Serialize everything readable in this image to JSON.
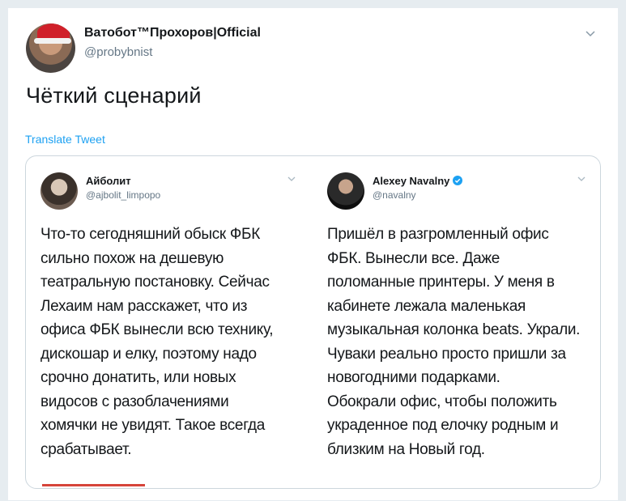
{
  "tweet": {
    "author_name": "Ватобот™Прохоров|Official",
    "author_handle": "@probybnist",
    "text": "Чёткий сценарий",
    "translate_label": "Translate Tweet",
    "caret_icon": "chevron-down-icon"
  },
  "media": {
    "left": {
      "author_name": "Айболит",
      "author_handle": "@ajbolit_limpopo",
      "lines": [
        "Что-то сегодняшний обыск ФБК",
        "сильно похож на дешевую",
        "театральную постановку. Сейчас",
        "Лехаим нам расскажет, что из",
        "офиса ФБК вынесли всю технику,",
        "дискошар и елку, поэтому надо",
        "срочно донатить, или новых",
        "видосов с разоблачениями",
        "хомячки не увидят. Такое всегда",
        "срабатывает."
      ]
    },
    "right": {
      "author_name": "Alexey Navalny",
      "author_handle": "@navalny",
      "verified": true,
      "lines": [
        "Пришёл в разгромленный офис",
        "ФБК. Вынесли все. Даже",
        "поломанные принтеры. У меня в",
        "кабинете лежала маленькая",
        "музыкальная колонка beats. Украли.",
        "Чуваки реально просто пришли за",
        "новогодними подарками.",
        "Обокрали офис, чтобы положить",
        "украденное под елочку родным и",
        "близким на Новый год."
      ]
    }
  },
  "colors": {
    "link": "#1da1f2",
    "secondary_text": "#657786",
    "verified": "#1da1f2"
  }
}
